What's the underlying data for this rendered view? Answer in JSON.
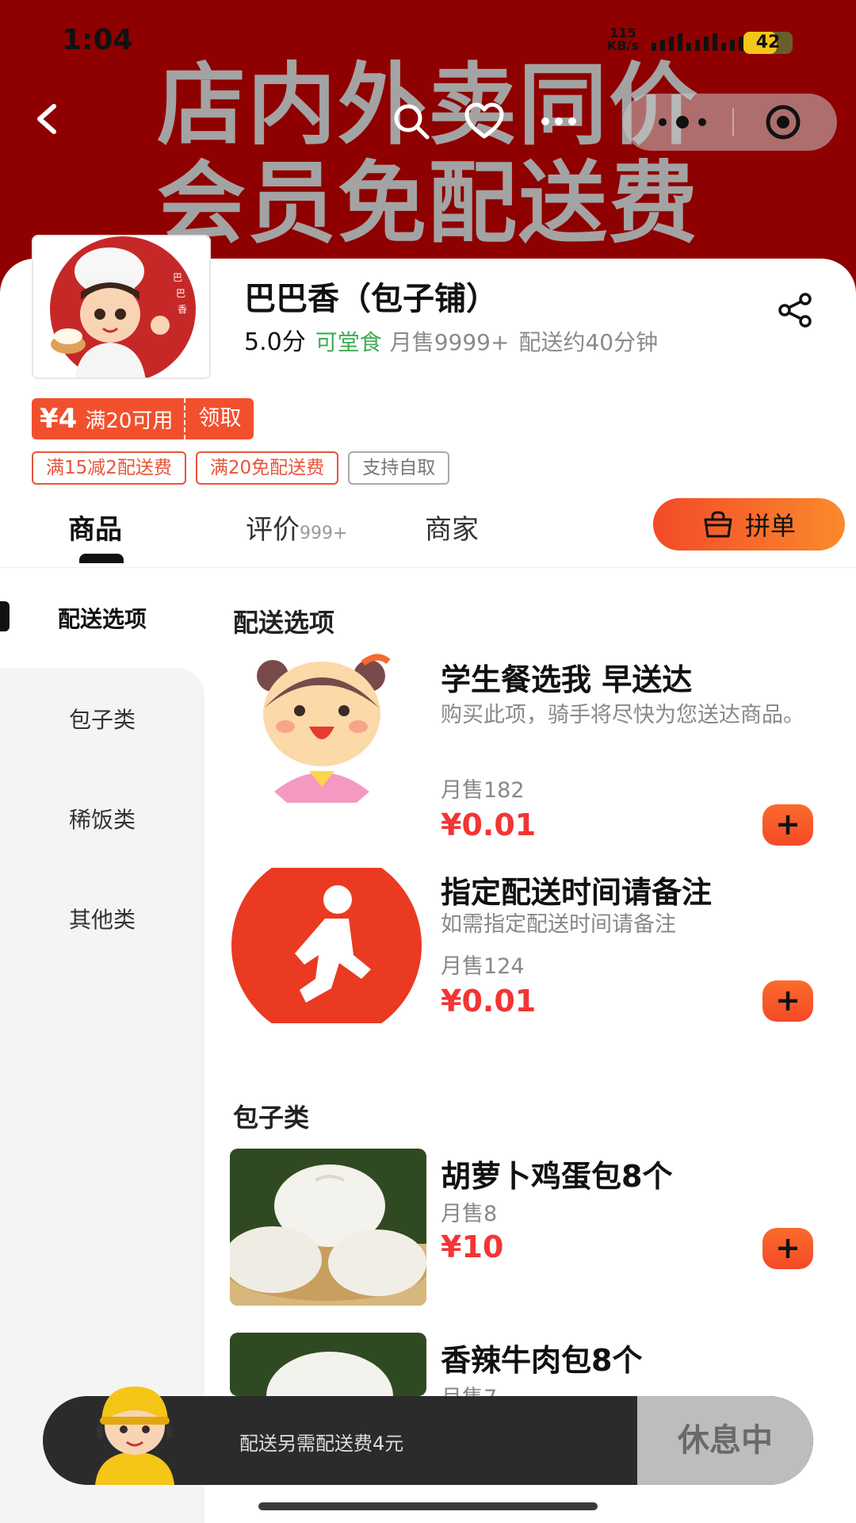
{
  "status_bar": {
    "time": "1:04",
    "network_speed": "115",
    "network_unit": "KB/s",
    "battery": "42"
  },
  "banner": {
    "line1": "店内外卖同价",
    "line2": "会员免配送费"
  },
  "nav": {
    "back_icon": "chevron-left-icon",
    "search_icon": "search-icon",
    "favorite_icon": "heart-icon",
    "more_icon": "more-dots-icon"
  },
  "shop": {
    "name": "巴巴香（包子铺）",
    "score": "5.0分",
    "dine_in": "可堂食",
    "monthly_sales": "月售9999+",
    "delivery_time": "配送约40分钟",
    "avatar_sign": "巴巴香"
  },
  "coupon": {
    "amount": "¥4",
    "condition": "满20可用",
    "action": "领取"
  },
  "promo_tags": [
    "满15减2配送费",
    "满20免配送费",
    "支持自取"
  ],
  "tabs": [
    {
      "label": "商品",
      "count": ""
    },
    {
      "label": "评价",
      "count": "999+"
    },
    {
      "label": "商家",
      "count": ""
    }
  ],
  "group_order": {
    "label": "拼单",
    "icon": "shopping-bag-icon"
  },
  "categories": [
    "配送选项",
    "包子类",
    "稀饭类",
    "其他类"
  ],
  "sections": [
    {
      "title": "配送选项",
      "items": [
        {
          "name": "学生餐选我 早送达",
          "desc": "购买此项，骑手将尽快为您送达商品。",
          "sales": "月售182",
          "price": "¥0.01"
        },
        {
          "name": "指定配送时间请备注",
          "desc": "如需指定配送时间请备注",
          "sales": "月售124",
          "price": "¥0.01"
        }
      ]
    },
    {
      "title": "包子类",
      "items": [
        {
          "name": "胡萝卜鸡蛋包8个",
          "sales": "月售8",
          "price": "¥10"
        },
        {
          "name": "香辣牛肉包8个",
          "sales": "月售7",
          "price": ""
        }
      ]
    }
  ],
  "cart": {
    "tip": "配送另需配送费4元",
    "status": "休息中"
  },
  "colors": {
    "banner": "#8f0000",
    "accent": "#f2502d",
    "price": "#f23535",
    "dine_in": "#3cad54"
  }
}
